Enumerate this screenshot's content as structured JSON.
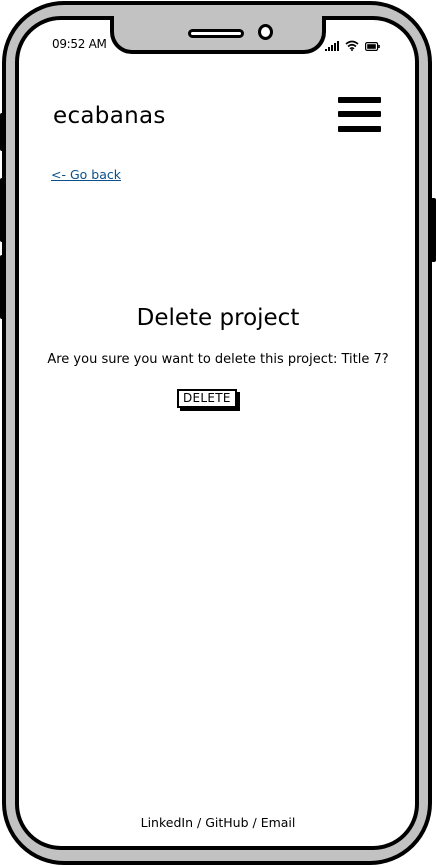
{
  "status_bar": {
    "time": "09:52 AM",
    "icons": [
      "signal-icon",
      "wifi-icon",
      "battery-icon"
    ]
  },
  "header": {
    "brand": "ecabanas",
    "menu_icon": "hamburger-menu-icon"
  },
  "nav": {
    "back_label": "<- Go back"
  },
  "main": {
    "title": "Delete project",
    "confirm_text": "Are you sure you want to delete this project: Title 7?",
    "delete_label": "DELETE"
  },
  "footer": {
    "links": [
      "LinkedIn",
      "GitHub",
      "Email"
    ],
    "separator": " / "
  },
  "colors": {
    "link": "#0a4f8a",
    "frame": "#000000",
    "bezel": "#c2c2c2"
  }
}
